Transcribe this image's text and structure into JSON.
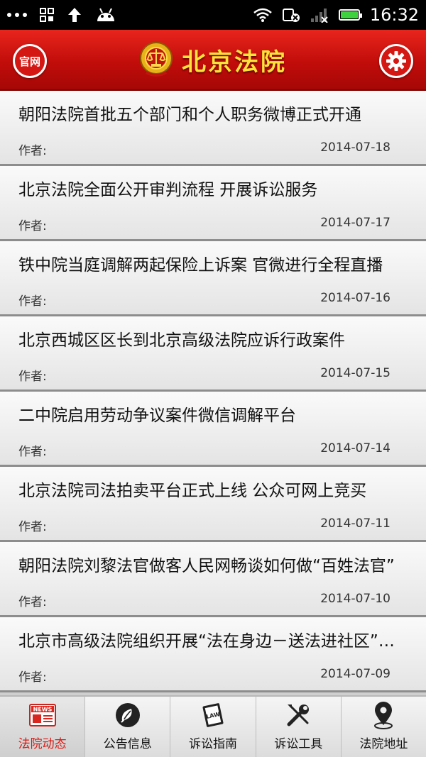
{
  "status_bar": {
    "time": "16:32"
  },
  "header": {
    "left_button": "官网",
    "title": "北京法院"
  },
  "author_label": "作者:",
  "articles": [
    {
      "title": "朝阳法院首批五个部门和个人职务微博正式开通",
      "author": "",
      "date": "2014-07-18"
    },
    {
      "title": "北京法院全面公开审判流程 开展诉讼服务",
      "author": "",
      "date": "2014-07-17"
    },
    {
      "title": "铁中院当庭调解两起保险上诉案 官微进行全程直播",
      "author": "",
      "date": "2014-07-16"
    },
    {
      "title": "北京西城区区长到北京高级法院应诉行政案件",
      "author": "",
      "date": "2014-07-15"
    },
    {
      "title": "二中院启用劳动争议案件微信调解平台",
      "author": "",
      "date": "2014-07-14"
    },
    {
      "title": "北京法院司法拍卖平台正式上线 公众可网上竞买",
      "author": "",
      "date": "2014-07-11"
    },
    {
      "title": "朝阳法院刘黎法官做客人民网畅谈如何做“百姓法官”",
      "author": "",
      "date": "2014-07-10"
    },
    {
      "title": "北京市高级法院组织开展“法在身边－送法进社区”活动",
      "author": "",
      "date": "2014-07-09"
    }
  ],
  "tabs": [
    {
      "label": "法院动态",
      "icon": "news-icon",
      "active": true
    },
    {
      "label": "公告信息",
      "icon": "leaf-icon",
      "active": false
    },
    {
      "label": "诉讼指南",
      "icon": "book-icon",
      "active": false
    },
    {
      "label": "诉讼工具",
      "icon": "tools-icon",
      "active": false
    },
    {
      "label": "法院地址",
      "icon": "location-icon",
      "active": false
    }
  ],
  "colors": {
    "header_red": "#c10d0a",
    "title_yellow": "#ffe23a",
    "active_tab": "#d81a14",
    "battery_green": "#3ed23e"
  }
}
